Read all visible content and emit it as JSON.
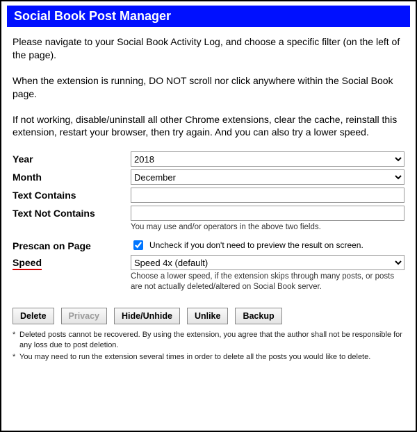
{
  "title": "Social Book Post Manager",
  "paragraphs": {
    "p1": "Please navigate to your Social Book Activity Log, and choose a specific filter (on the left of the page).",
    "p2": "When the extension is running, DO NOT scroll nor click anywhere within the Social Book page.",
    "p3": "If not working, disable/uninstall all other Chrome extensions, clear the cache, reinstall this extension, restart your browser, then try again. And you can also try a lower speed."
  },
  "form": {
    "year": {
      "label": "Year",
      "value": "2018"
    },
    "month": {
      "label": "Month",
      "value": "December"
    },
    "text_contains": {
      "label": "Text Contains",
      "value": ""
    },
    "text_not_contains": {
      "label": "Text Not Contains",
      "value": "",
      "hint": "You may use and/or operators in the above two fields."
    },
    "prescan": {
      "label": "Prescan on Page",
      "checked": true,
      "desc": "Uncheck if you don't need to preview the result on screen."
    },
    "speed": {
      "label": "Speed",
      "value": "Speed 4x (default)",
      "hint": "Choose a lower speed, if the extension skips through many posts, or posts are not actually deleted/altered on Social Book server."
    }
  },
  "buttons": {
    "delete": "Delete",
    "privacy": "Privacy",
    "hide": "Hide/Unhide",
    "unlike": "Unlike",
    "backup": "Backup"
  },
  "footnotes": {
    "f1": "Deleted posts cannot be recovered. By using the extension, you agree that the author shall not be responsible for any loss due to post deletion.",
    "f2": "You may need to run the extension several times in order to delete all the posts you would like to delete."
  }
}
